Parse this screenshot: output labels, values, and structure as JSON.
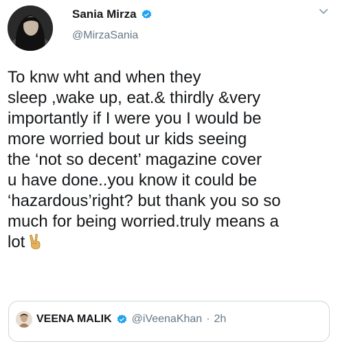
{
  "author": {
    "display_name": "Sania Mirza",
    "handle": "@MirzaSania",
    "verified": true,
    "avatar_icon": "profile-photo"
  },
  "tweet": {
    "lines": [
      "To knw wht and when they",
      "sleep ,wake up, eat.& thirdly &very",
      "importantly if I were you I would be",
      "more worried bout ur kids seeing",
      "the ‘not so decent’ magazine cover",
      "u have done..you know it could be",
      "‘hazardous’right? but thank you so so",
      "much for being worried.truly means a",
      "lot"
    ],
    "trailing_emoji": "victory-hand-emoji"
  },
  "quoted_tweet": {
    "display_name": "VEENA MALIK",
    "handle": "@iVeenaKhan",
    "separator": "·",
    "time": "2h",
    "verified": true
  },
  "colors": {
    "text_primary": "#14171a",
    "text_secondary": "#657786",
    "verified_blue": "#1da1f2",
    "border": "#ccd6dd"
  }
}
